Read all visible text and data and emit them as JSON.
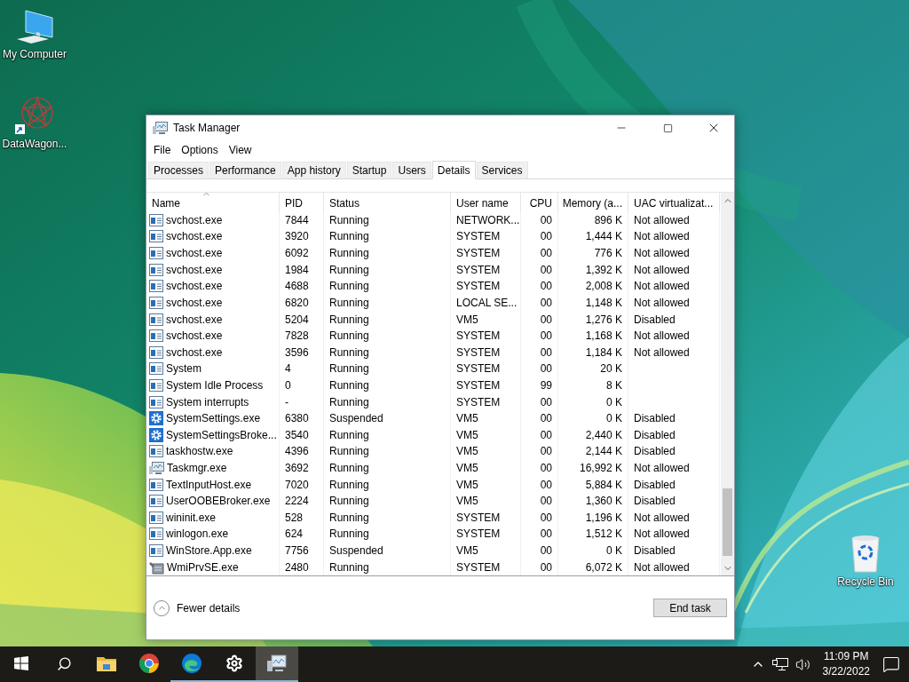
{
  "desktop": {
    "icons": [
      {
        "label": "My Computer",
        "kind": "computer"
      },
      {
        "label": "DataWagon...",
        "kind": "shortcut"
      },
      {
        "label": "Recycle Bin",
        "kind": "recycle"
      }
    ]
  },
  "window": {
    "title": "Task Manager",
    "menu": [
      "File",
      "Options",
      "View"
    ],
    "tabs": [
      {
        "label": "Processes",
        "selected": false
      },
      {
        "label": "Performance",
        "selected": false
      },
      {
        "label": "App history",
        "selected": false
      },
      {
        "label": "Startup",
        "selected": false
      },
      {
        "label": "Users",
        "selected": false
      },
      {
        "label": "Details",
        "selected": true
      },
      {
        "label": "Services",
        "selected": false
      }
    ],
    "table": {
      "columns": [
        {
          "label": "Name",
          "sorted": true
        },
        {
          "label": "PID",
          "sorted": false
        },
        {
          "label": "Status",
          "sorted": false
        },
        {
          "label": "User name",
          "sorted": false
        },
        {
          "label": "CPU",
          "sorted": false
        },
        {
          "label": "Memory (a...",
          "sorted": false
        },
        {
          "label": "UAC virtualizat...",
          "sorted": false
        }
      ],
      "rows": [
        {
          "kind": "app",
          "cells": [
            "svchost.exe",
            "7844",
            "Running",
            "NETWORK...",
            "00",
            "896 K",
            "Not allowed"
          ]
        },
        {
          "kind": "app",
          "cells": [
            "svchost.exe",
            "3920",
            "Running",
            "SYSTEM",
            "00",
            "1,444 K",
            "Not allowed"
          ]
        },
        {
          "kind": "app",
          "cells": [
            "svchost.exe",
            "6092",
            "Running",
            "SYSTEM",
            "00",
            "776 K",
            "Not allowed"
          ]
        },
        {
          "kind": "app",
          "cells": [
            "svchost.exe",
            "1984",
            "Running",
            "SYSTEM",
            "00",
            "1,392 K",
            "Not allowed"
          ]
        },
        {
          "kind": "app",
          "cells": [
            "svchost.exe",
            "4688",
            "Running",
            "SYSTEM",
            "00",
            "2,008 K",
            "Not allowed"
          ]
        },
        {
          "kind": "app",
          "cells": [
            "svchost.exe",
            "6820",
            "Running",
            "LOCAL SE...",
            "00",
            "1,148 K",
            "Not allowed"
          ]
        },
        {
          "kind": "app",
          "cells": [
            "svchost.exe",
            "5204",
            "Running",
            "VM5",
            "00",
            "1,276 K",
            "Disabled"
          ]
        },
        {
          "kind": "app",
          "cells": [
            "svchost.exe",
            "7828",
            "Running",
            "SYSTEM",
            "00",
            "1,168 K",
            "Not allowed"
          ]
        },
        {
          "kind": "app",
          "cells": [
            "svchost.exe",
            "3596",
            "Running",
            "SYSTEM",
            "00",
            "1,184 K",
            "Not allowed"
          ]
        },
        {
          "kind": "app",
          "cells": [
            "System",
            "4",
            "Running",
            "SYSTEM",
            "00",
            "20 K"
          ]
        },
        {
          "kind": "app",
          "cells": [
            "System Idle Process",
            "0",
            "Running",
            "SYSTEM",
            "99",
            "8 K"
          ]
        },
        {
          "kind": "app",
          "cells": [
            "System interrupts",
            "-",
            "Running",
            "SYSTEM",
            "00",
            "0 K"
          ]
        },
        {
          "kind": "settings",
          "cells": [
            "SystemSettings.exe",
            "6380",
            "Suspended",
            "VM5",
            "00",
            "0 K",
            "Disabled"
          ]
        },
        {
          "kind": "settings",
          "cells": [
            "SystemSettingsBroke...",
            "3540",
            "Running",
            "VM5",
            "00",
            "2,440 K",
            "Disabled"
          ]
        },
        {
          "kind": "app",
          "cells": [
            "taskhostw.exe",
            "4396",
            "Running",
            "VM5",
            "00",
            "2,144 K",
            "Disabled"
          ]
        },
        {
          "kind": "monitor",
          "cells": [
            "Taskmgr.exe",
            "3692",
            "Running",
            "VM5",
            "00",
            "16,992 K",
            "Not allowed"
          ]
        },
        {
          "kind": "app",
          "cells": [
            "TextInputHost.exe",
            "7020",
            "Running",
            "VM5",
            "00",
            "5,884 K",
            "Disabled"
          ]
        },
        {
          "kind": "app",
          "cells": [
            "UserOOBEBroker.exe",
            "2224",
            "Running",
            "VM5",
            "00",
            "1,360 K",
            "Disabled"
          ]
        },
        {
          "kind": "app",
          "cells": [
            "wininit.exe",
            "528",
            "Running",
            "SYSTEM",
            "00",
            "1,196 K",
            "Not allowed"
          ]
        },
        {
          "kind": "app",
          "cells": [
            "winlogon.exe",
            "624",
            "Running",
            "SYSTEM",
            "00",
            "1,512 K",
            "Not allowed"
          ]
        },
        {
          "kind": "app",
          "cells": [
            "WinStore.App.exe",
            "7756",
            "Suspended",
            "VM5",
            "00",
            "0 K",
            "Disabled"
          ]
        },
        {
          "kind": "tool",
          "cells": [
            "WmiPrvSE.exe",
            "2480",
            "Running",
            "SYSTEM",
            "00",
            "6,072 K",
            "Not allowed"
          ]
        }
      ]
    },
    "footer": {
      "toggle": "Fewer details",
      "button": "End task"
    }
  },
  "taskbar": {
    "items": [
      {
        "kind": "start",
        "running": false,
        "active": false
      },
      {
        "kind": "search",
        "running": false,
        "active": false
      },
      {
        "kind": "explorer",
        "running": false,
        "active": false
      },
      {
        "kind": "chrome",
        "running": false,
        "active": false
      },
      {
        "kind": "edge",
        "running": true,
        "active": false
      },
      {
        "kind": "settings",
        "running": true,
        "active": false
      },
      {
        "kind": "taskmgr",
        "running": true,
        "active": true
      }
    ],
    "time": "11:09 PM",
    "date": "3/22/2022"
  }
}
